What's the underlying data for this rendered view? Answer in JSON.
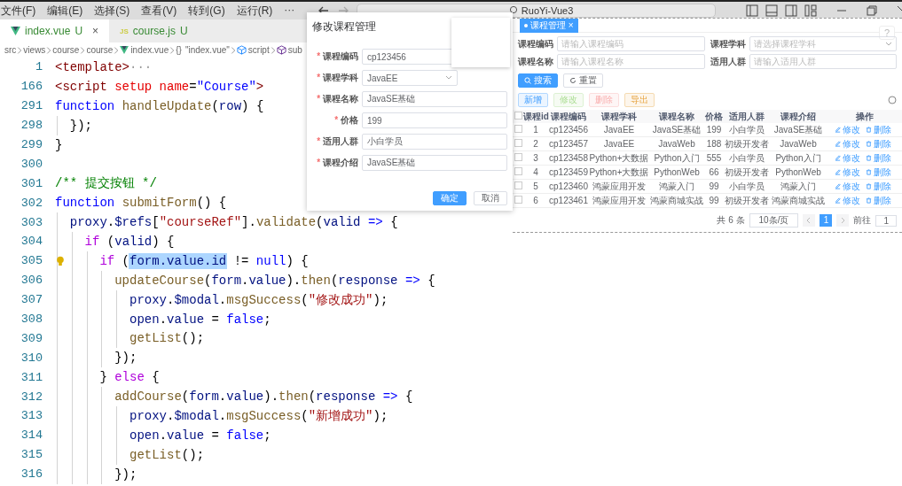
{
  "menu": [
    "文件(F)",
    "编辑(E)",
    "选择(S)",
    "查看(V)",
    "转到(G)",
    "运行(R)",
    "···"
  ],
  "command_center": {
    "text": "RuoYi-Vue3"
  },
  "tabs": [
    {
      "label": "index.vue",
      "status": "U",
      "kind": "vue",
      "close": "×",
      "selected": true
    },
    {
      "label": "course.js",
      "status": "U",
      "kind": "js",
      "icon_text": "JS",
      "selected": false
    }
  ],
  "breadcrumb": [
    {
      "text": "src",
      "kind": "plain"
    },
    {
      "text": "views",
      "kind": "plain"
    },
    {
      "text": "course",
      "kind": "plain"
    },
    {
      "text": "course",
      "kind": "plain"
    },
    {
      "text": "index.vue",
      "kind": "vue"
    },
    {
      "text": "\"index.vue\"",
      "kind": "object",
      "prefix": "{}"
    },
    {
      "text": "script",
      "kind": "module"
    },
    {
      "text": "sub",
      "kind": "method"
    }
  ],
  "code_lines": [
    {
      "number": "1",
      "tokens": [
        {
          "text": "<template>",
          "kind": "tag"
        },
        {
          "text": "···",
          "kind": "fold"
        }
      ]
    },
    {
      "number": "166",
      "tokens": [
        {
          "text": "<script",
          "kind": "tag"
        },
        {
          "text": " setup name",
          "kind": "attr"
        },
        {
          "text": "=",
          "kind": "punct"
        },
        {
          "text": "\"Course\"",
          "kind": "attrval"
        },
        {
          "text": ">",
          "kind": "tag"
        }
      ]
    },
    {
      "number": "291",
      "tokens": [
        {
          "text": "function ",
          "kind": "keyword"
        },
        {
          "text": "handleUpdate",
          "kind": "func"
        },
        {
          "text": "(",
          "kind": "punct"
        },
        {
          "text": "row",
          "kind": "variable"
        },
        {
          "text": ") {",
          "kind": "punct"
        }
      ]
    },
    {
      "number": "298",
      "tokens": [
        {
          "text": "  });",
          "kind": "punct"
        }
      ]
    },
    {
      "number": "299",
      "tokens": [
        {
          "text": "}",
          "kind": "punct"
        }
      ]
    },
    {
      "number": "300"
    },
    {
      "number": "301",
      "tokens": [
        {
          "text": "/** 提交按钮 */",
          "kind": "comment"
        }
      ]
    },
    {
      "number": "302",
      "tokens": [
        {
          "text": "function ",
          "kind": "keyword"
        },
        {
          "text": "submitForm",
          "kind": "func"
        },
        {
          "text": "() {",
          "kind": "punct"
        }
      ]
    },
    {
      "number": "303",
      "tokens": [
        {
          "text": "  proxy",
          "kind": "variable"
        },
        {
          "text": ".",
          "kind": "punct"
        },
        {
          "text": "$refs",
          "kind": "variable"
        },
        {
          "text": "[",
          "kind": "punct"
        },
        {
          "text": "\"courseRef\"",
          "kind": "string"
        },
        {
          "text": "].",
          "kind": "punct"
        },
        {
          "text": "validate",
          "kind": "func"
        },
        {
          "text": "(",
          "kind": "punct"
        },
        {
          "text": "valid",
          "kind": "variable"
        },
        {
          "text": " =>",
          "kind": "keyword"
        },
        {
          "text": " {",
          "kind": "punct"
        }
      ]
    },
    {
      "number": "304",
      "tokens": [
        {
          "text": "    if",
          "kind": "control"
        },
        {
          "text": " (",
          "kind": "punct"
        },
        {
          "text": "valid",
          "kind": "variable"
        },
        {
          "text": ") {",
          "kind": "punct"
        }
      ]
    },
    {
      "number": "305",
      "hint": true,
      "tokens": [
        {
          "text": "      if",
          "kind": "control"
        },
        {
          "text": " (",
          "kind": "punct"
        },
        {
          "text": "form.value.id",
          "kind": "variable",
          "highlighted": true
        },
        {
          "text": " != ",
          "kind": "punct"
        },
        {
          "text": "null",
          "kind": "keyword"
        },
        {
          "text": ") {",
          "kind": "punct"
        }
      ]
    },
    {
      "number": "306",
      "tokens": [
        {
          "text": "        updateCourse",
          "kind": "func"
        },
        {
          "text": "(",
          "kind": "punct"
        },
        {
          "text": "form",
          "kind": "variable"
        },
        {
          "text": ".",
          "kind": "punct"
        },
        {
          "text": "value",
          "kind": "variable"
        },
        {
          "text": ").",
          "kind": "punct"
        },
        {
          "text": "then",
          "kind": "func"
        },
        {
          "text": "(",
          "kind": "punct"
        },
        {
          "text": "response",
          "kind": "variable"
        },
        {
          "text": " =>",
          "kind": "keyword"
        },
        {
          "text": " {",
          "kind": "punct"
        }
      ]
    },
    {
      "number": "307",
      "tokens": [
        {
          "text": "          proxy",
          "kind": "variable"
        },
        {
          "text": ".",
          "kind": "punct"
        },
        {
          "text": "$modal",
          "kind": "variable"
        },
        {
          "text": ".",
          "kind": "punct"
        },
        {
          "text": "msgSuccess",
          "kind": "func"
        },
        {
          "text": "(",
          "kind": "punct"
        },
        {
          "text": "\"修改成功\"",
          "kind": "string"
        },
        {
          "text": ");",
          "kind": "punct"
        }
      ]
    },
    {
      "number": "308",
      "tokens": [
        {
          "text": "          open",
          "kind": "variable"
        },
        {
          "text": ".",
          "kind": "punct"
        },
        {
          "text": "value",
          "kind": "variable"
        },
        {
          "text": " = ",
          "kind": "punct"
        },
        {
          "text": "false",
          "kind": "keyword"
        },
        {
          "text": ";",
          "kind": "punct"
        }
      ]
    },
    {
      "number": "309",
      "tokens": [
        {
          "text": "          getList",
          "kind": "func"
        },
        {
          "text": "();",
          "kind": "punct"
        }
      ]
    },
    {
      "number": "310",
      "tokens": [
        {
          "text": "        });",
          "kind": "punct"
        }
      ]
    },
    {
      "number": "311",
      "tokens": [
        {
          "text": "      } ",
          "kind": "punct"
        },
        {
          "text": "else",
          "kind": "control"
        },
        {
          "text": " {",
          "kind": "punct"
        }
      ]
    },
    {
      "number": "312",
      "tokens": [
        {
          "text": "        addCourse",
          "kind": "func"
        },
        {
          "text": "(",
          "kind": "punct"
        },
        {
          "text": "form",
          "kind": "variable"
        },
        {
          "text": ".",
          "kind": "punct"
        },
        {
          "text": "value",
          "kind": "variable"
        },
        {
          "text": ").",
          "kind": "punct"
        },
        {
          "text": "then",
          "kind": "func"
        },
        {
          "text": "(",
          "kind": "punct"
        },
        {
          "text": "response",
          "kind": "variable"
        },
        {
          "text": " =>",
          "kind": "keyword"
        },
        {
          "text": " {",
          "kind": "punct"
        }
      ]
    },
    {
      "number": "313",
      "tokens": [
        {
          "text": "          proxy",
          "kind": "variable"
        },
        {
          "text": ".",
          "kind": "punct"
        },
        {
          "text": "$modal",
          "kind": "variable"
        },
        {
          "text": ".",
          "kind": "punct"
        },
        {
          "text": "msgSuccess",
          "kind": "func"
        },
        {
          "text": "(",
          "kind": "punct"
        },
        {
          "text": "\"新增成功\"",
          "kind": "string"
        },
        {
          "text": ");",
          "kind": "punct"
        }
      ]
    },
    {
      "number": "314",
      "tokens": [
        {
          "text": "          open",
          "kind": "variable"
        },
        {
          "text": ".",
          "kind": "punct"
        },
        {
          "text": "value",
          "kind": "variable"
        },
        {
          "text": " = ",
          "kind": "punct"
        },
        {
          "text": "false",
          "kind": "keyword"
        },
        {
          "text": ";",
          "kind": "punct"
        }
      ]
    },
    {
      "number": "315",
      "tokens": [
        {
          "text": "          getList",
          "kind": "func"
        },
        {
          "text": "();",
          "kind": "punct"
        }
      ]
    },
    {
      "number": "316",
      "tokens": [
        {
          "text": "        });",
          "kind": "punct"
        }
      ]
    }
  ],
  "web_page": {
    "tab": {
      "label": "课程管理",
      "close": "×",
      "selected": true
    },
    "help": "?",
    "search_fields": [
      {
        "label": "课程编码",
        "placeholder": "请输入课程编码",
        "kind": "input"
      },
      {
        "label": "课程学科",
        "placeholder": "请选择课程学科",
        "kind": "select"
      },
      {
        "label": "课程名称",
        "placeholder": "请输入课程名称",
        "kind": "input"
      },
      {
        "label": "适用人群",
        "placeholder": "请输入适用人群",
        "kind": "input"
      }
    ],
    "search_buttons": [
      {
        "label": "搜索",
        "kind": "primary"
      },
      {
        "label": "重置",
        "kind": "default"
      }
    ],
    "toolbar": [
      {
        "label": "新增",
        "kind": "primary",
        "disabled": false
      },
      {
        "label": "修改",
        "kind": "success",
        "disabled": true
      },
      {
        "label": "删除",
        "kind": "danger",
        "disabled": true
      },
      {
        "label": "导出",
        "kind": "warning",
        "disabled": false
      }
    ],
    "table": {
      "all_checked": false,
      "columns": [
        "课程id",
        "课程编码",
        "课程学科",
        "课程名称",
        "价格",
        "适用人群",
        "课程介绍",
        "操作"
      ],
      "rows": [
        {
          "checked": false,
          "cells": [
            "1",
            "cp123456",
            "JavaEE",
            "JavaSE基础",
            "199",
            "小白学员",
            "JavaSE基础"
          ],
          "actions": [
            "修改",
            "删除"
          ]
        },
        {
          "checked": false,
          "cells": [
            "2",
            "cp123457",
            "JavaEE",
            "JavaWeb",
            "188",
            "初级开发者",
            "JavaWeb"
          ],
          "actions": [
            "修改",
            "删除"
          ]
        },
        {
          "checked": false,
          "cells": [
            "3",
            "cp123458",
            "Python+大数据",
            "Python入门",
            "555",
            "小白学员",
            "Python入门"
          ],
          "actions": [
            "修改",
            "删除"
          ]
        },
        {
          "checked": false,
          "cells": [
            "4",
            "cp123459",
            "Python+大数据",
            "PythonWeb",
            "66",
            "初级开发者",
            "PythonWeb"
          ],
          "actions": [
            "修改",
            "删除"
          ]
        },
        {
          "checked": false,
          "cells": [
            "5",
            "cp123460",
            "鸿蒙应用开发",
            "鸿蒙入门",
            "99",
            "小白学员",
            "鸿蒙入门"
          ],
          "actions": [
            "修改",
            "删除"
          ]
        },
        {
          "checked": false,
          "cells": [
            "6",
            "cp123461",
            "鸿蒙应用开发",
            "鸿蒙商城实战",
            "99",
            "初级开发者",
            "鸿蒙商城实战"
          ],
          "actions": [
            "修改",
            "删除"
          ]
        }
      ]
    },
    "pagination": {
      "total": "共 6 条",
      "page_size": "10条/页",
      "pages": [
        {
          "label": "1",
          "selected": true
        }
      ],
      "goto_label": "前往",
      "goto_value": "1"
    }
  },
  "dialog": {
    "title": "修改课程管理",
    "fields": [
      {
        "label": "课程编码",
        "required_mark": "*",
        "value": "cp123456",
        "kind": "input"
      },
      {
        "label": "课程学科",
        "required_mark": "*",
        "value": "JavaEE",
        "kind": "select"
      },
      {
        "label": "课程名称",
        "required_mark": "*",
        "value": "JavaSE基础",
        "kind": "input"
      },
      {
        "label": "价格",
        "required_mark": "*",
        "value": "199",
        "kind": "input"
      },
      {
        "label": "适用人群",
        "required_mark": "*",
        "value": "小白学员",
        "kind": "input"
      },
      {
        "label": "课程介绍",
        "required_mark": "*",
        "value": "JavaSE基础",
        "kind": "input"
      }
    ],
    "buttons": [
      {
        "label": "确定",
        "kind": "primary"
      },
      {
        "label": "取消",
        "kind": "default"
      }
    ]
  }
}
